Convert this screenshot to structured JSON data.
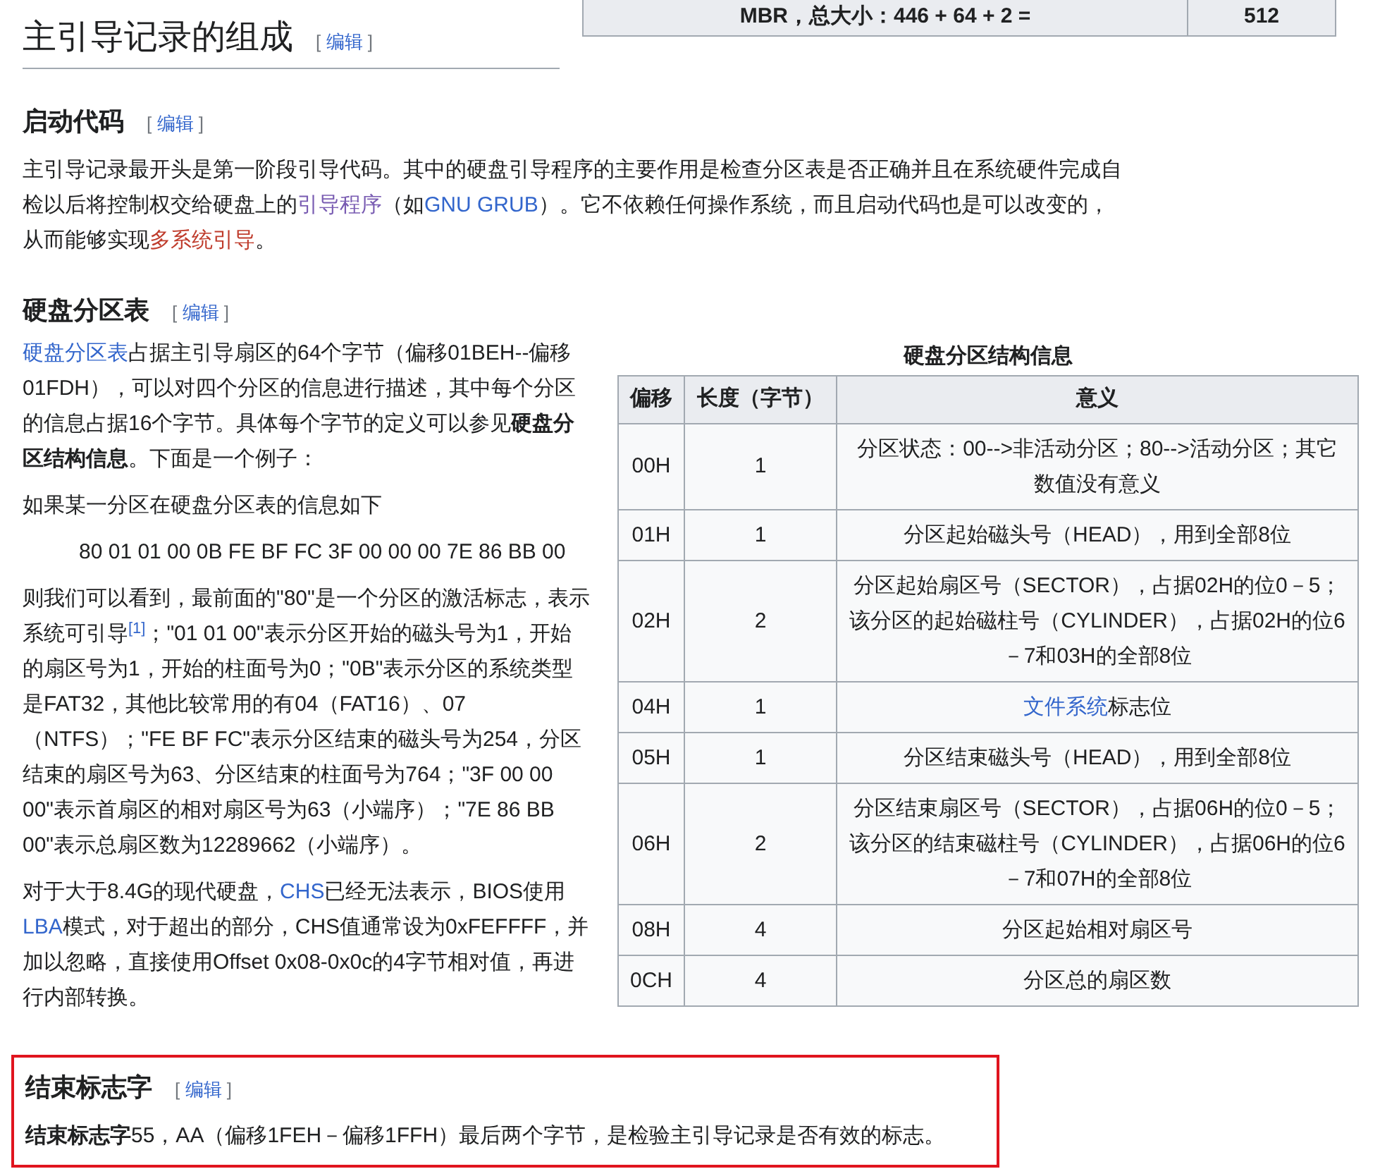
{
  "top_table_row": {
    "label": "MBR，总大小：446 + 64 + 2 =",
    "value": "512"
  },
  "title": {
    "text": "主引导记录的组成",
    "edit": {
      "open": "[",
      "label": "编辑",
      "close": "]"
    }
  },
  "sections": [
    {
      "heading": "启动代码",
      "edit": {
        "open": "[",
        "label": "编辑",
        "close": "]"
      },
      "paragraphs": [
        [
          {
            "kind": "text",
            "text": "主引导记录最开头是第一阶段引导代码。其中的硬盘引导程序的主要作用是检查分区表是否正确并且在系统硬件完成自检以后将控制权交给硬盘上的"
          },
          {
            "kind": "visited",
            "text": "引导程序"
          },
          {
            "kind": "text",
            "text": "（如"
          },
          {
            "kind": "link",
            "text": "GNU GRUB"
          },
          {
            "kind": "text",
            "text": "）。它不依赖任何操作系统，而且启动代码也是可以改变的，从而能够实现"
          },
          {
            "kind": "redlink",
            "text": "多系统引导"
          },
          {
            "kind": "text",
            "text": "。"
          }
        ]
      ]
    },
    {
      "heading": "硬盘分区表",
      "edit": {
        "open": "[",
        "label": "编辑",
        "close": "]"
      },
      "paragraphs": [
        [
          {
            "kind": "link",
            "text": "硬盘分区表"
          },
          {
            "kind": "text",
            "text": "占据主引导扇区的64个字节（偏移01BEH--偏移01FDH），可以对四个分区的信息进行描述，其中每个分区的信息占据16个字节。具体每个字节的定义可以参见"
          },
          {
            "kind": "bold",
            "text": "硬盘分区结构信息"
          },
          {
            "kind": "text",
            "text": "。下面是一个例子："
          }
        ],
        [
          {
            "kind": "text",
            "text": "如果某一分区在硬盘分区表的信息如下"
          }
        ],
        [
          {
            "kind": "indent",
            "text": "80 01 01 00 0B FE BF FC 3F 00 00 00 7E 86 BB 00"
          }
        ],
        [
          {
            "kind": "text",
            "text": "则我们可以看到，最前面的\"80\"是一个分区的激活标志，表示系统可引导"
          },
          {
            "kind": "ref",
            "text": "[1]"
          },
          {
            "kind": "text",
            "text": "；\"01 01 00\"表示分区开始的磁头号为1，开始的扇区号为1，开始的柱面号为0；\"0B\"表示分区的系统类型是FAT32，其他比较常用的有04（FAT16）、07（NTFS）；\"FE BF FC\"表示分区结束的磁头号为254，分区结束的扇区号为63、分区结束的柱面号为764；\"3F 00 00 00\"表示首扇区的相对扇区号为63（小端序）；\"7E 86 BB 00\"表示总扇区数为12289662（小端序）。"
          }
        ],
        [
          {
            "kind": "text",
            "text": "对于大于8.4G的现代硬盘，"
          },
          {
            "kind": "link",
            "text": "CHS"
          },
          {
            "kind": "text",
            "text": "已经无法表示，BIOS使用"
          },
          {
            "kind": "link",
            "text": "LBA"
          },
          {
            "kind": "text",
            "text": "模式，对于超出的部分，CHS值通常设为0xFEFFFF，并加以忽略，直接使用Offset 0x08-0x0c的4字节相对值，再进行内部转换。"
          }
        ]
      ],
      "table": {
        "caption": "硬盘分区结构信息",
        "columns": [
          "偏移",
          "长度（字节）",
          "意义"
        ],
        "rows": [
          {
            "offset": "00H",
            "length": "1",
            "meaning": [
              {
                "kind": "text",
                "text": "分区状态：00-->非活动分区；80-->活动分区；其它数值没有意义"
              }
            ]
          },
          {
            "offset": "01H",
            "length": "1",
            "meaning": [
              {
                "kind": "text",
                "text": "分区起始磁头号（HEAD），用到全部8位"
              }
            ]
          },
          {
            "offset": "02H",
            "length": "2",
            "meaning": [
              {
                "kind": "text",
                "text": "分区起始扇区号（SECTOR），占据02H的位0－5；该分区的起始磁柱号（CYLINDER），占据02H的位6－7和03H的全部8位"
              }
            ]
          },
          {
            "offset": "04H",
            "length": "1",
            "meaning": [
              {
                "kind": "link",
                "text": "文件系统"
              },
              {
                "kind": "text",
                "text": "标志位"
              }
            ]
          },
          {
            "offset": "05H",
            "length": "1",
            "meaning": [
              {
                "kind": "text",
                "text": "分区结束磁头号（HEAD），用到全部8位"
              }
            ]
          },
          {
            "offset": "06H",
            "length": "2",
            "meaning": [
              {
                "kind": "text",
                "text": "分区结束扇区号（SECTOR），占据06H的位0－5；该分区的结束磁柱号（CYLINDER），占据06H的位6－7和07H的全部8位"
              }
            ]
          },
          {
            "offset": "08H",
            "length": "4",
            "meaning": [
              {
                "kind": "text",
                "text": "分区起始相对扇区号"
              }
            ]
          },
          {
            "offset": "0CH",
            "length": "4",
            "meaning": [
              {
                "kind": "text",
                "text": "分区总的扇区数"
              }
            ]
          }
        ]
      }
    },
    {
      "heading": "结束标志字",
      "edit": {
        "open": "[",
        "label": "编辑",
        "close": "]"
      },
      "highlighted": true,
      "paragraphs": [
        [
          {
            "kind": "bold",
            "text": "结束标志字"
          },
          {
            "kind": "text",
            "text": "55，AA（偏移1FEH－偏移1FFH）最后两个字节，是检验主引导记录是否有效的标志。"
          }
        ]
      ]
    }
  ]
}
